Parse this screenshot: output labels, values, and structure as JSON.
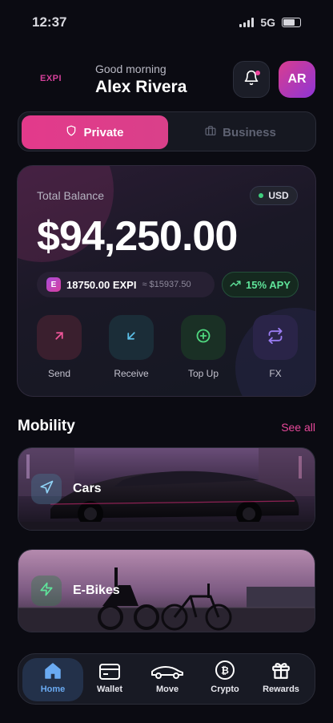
{
  "status": {
    "time": "12:37",
    "network": "5G"
  },
  "header": {
    "logo": "EXPI",
    "greeting": "Good morning",
    "user_name": "Alex Rivera",
    "avatar_initials": "AR"
  },
  "account_switch": {
    "options": [
      {
        "label": "Private",
        "icon": "shield-icon",
        "active": true
      },
      {
        "label": "Business",
        "icon": "briefcase-icon",
        "active": false
      }
    ]
  },
  "balance": {
    "label": "Total Balance",
    "currency": "USD",
    "amount": "$94,250.00",
    "token_symbol": "E",
    "token_amount": "18750.00 EXPI",
    "token_fiat": "≈ $15937.50",
    "apy": "15% APY"
  },
  "actions": [
    {
      "label": "Send",
      "icon": "arrow-up-right-icon",
      "color": "#f0569a"
    },
    {
      "label": "Receive",
      "icon": "arrow-down-left-icon",
      "color": "#5cc0e8"
    },
    {
      "label": "Top Up",
      "icon": "plus-circle-icon",
      "color": "#4fd67e"
    },
    {
      "label": "FX",
      "icon": "swap-icon",
      "color": "#9a7cf2"
    }
  ],
  "mobility": {
    "title": "Mobility",
    "see_all": "See all",
    "items": [
      {
        "label": "Cars",
        "icon": "navigation-icon"
      },
      {
        "label": "E-Bikes",
        "icon": "lightning-icon"
      }
    ]
  },
  "tabs": [
    {
      "label": "Home",
      "icon": "home-icon",
      "active": true
    },
    {
      "label": "Wallet",
      "icon": "wallet-icon",
      "active": false
    },
    {
      "label": "Move",
      "icon": "car-icon",
      "active": false
    },
    {
      "label": "Crypto",
      "icon": "bitcoin-icon",
      "active": false
    },
    {
      "label": "Rewards",
      "icon": "gift-icon",
      "active": false
    }
  ],
  "colors": {
    "accent": "#e33a8b",
    "background": "#0b0b12",
    "positive": "#5fe49a",
    "tab_active": "#6aaaf2"
  }
}
